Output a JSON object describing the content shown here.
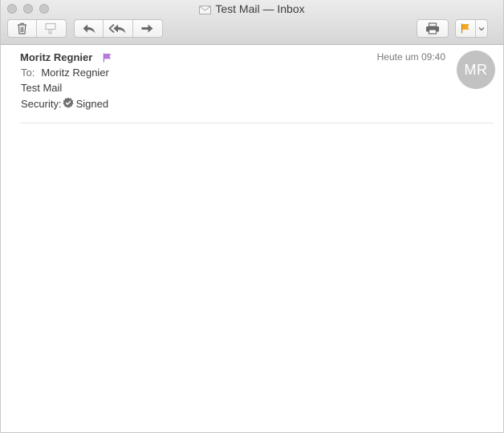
{
  "window": {
    "title": "Test Mail — Inbox"
  },
  "toolbar": {
    "buttons": [
      "trash-icon",
      "junk-icon",
      "reply-icon",
      "reply-all-icon",
      "forward-icon",
      "print-icon",
      "flag-icon",
      "chevron-down-icon"
    ],
    "flag_color": "#f5a623"
  },
  "message": {
    "sender": "Moritz Regnier",
    "sender_flag_color": "#b57be0",
    "date": "Heute um 09:40",
    "avatar_initials": "MR",
    "to_label": "To:",
    "to_value": "Moritz Regnier",
    "subject": "Test Mail",
    "security_label": "Security:",
    "security_value": "Signed"
  }
}
